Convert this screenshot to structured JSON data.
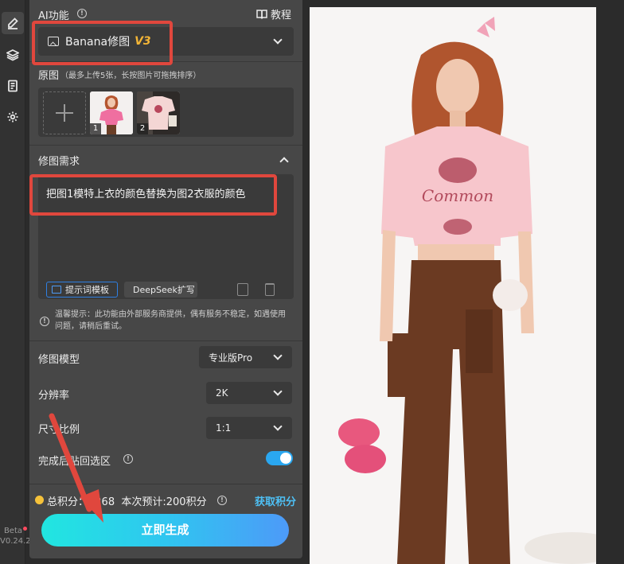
{
  "header": {
    "title": "AI功能",
    "tutorial_label": "教程"
  },
  "model_select": {
    "name": "Banana修图",
    "version_badge": "V3"
  },
  "originals": {
    "title": "原图",
    "hint": "（最多上传5张，长按图片可拖拽排序）",
    "thumbnails": [
      {
        "index": "1"
      },
      {
        "index": "2"
      }
    ]
  },
  "requirement": {
    "title": "修图需求",
    "text": "把图1模特上衣的颜色替换为图2衣服的颜色",
    "template_button": "提示词模板",
    "deepseek_button": "DeepSeek扩写"
  },
  "warning": {
    "text": "温馨提示：此功能由外部服务商提供，偶有服务不稳定，如遇使用问题，请稍后重试。"
  },
  "settings": {
    "model_label": "修图模型",
    "model_value": "专业版Pro",
    "resolution_label": "分辨率",
    "resolution_value": "2K",
    "ratio_label": "尺寸比例",
    "ratio_value": "1:1",
    "paste_back_label": "完成后贴回选区",
    "paste_back_on": true
  },
  "footer": {
    "total_points_label": "总积分：",
    "total_points_value": "7268",
    "estimate_label": "本次预计:200积分",
    "get_points": "获取积分",
    "generate_button": "立即生成"
  },
  "app": {
    "beta": "Beta",
    "version": "V0.24.2"
  },
  "colors": {
    "accent_blue": "#2aa7f0",
    "badge_gold": "#f3b536",
    "highlight_red": "#e0473d",
    "generate_gradient_start": "#21e6e0",
    "generate_gradient_end": "#4d9af8"
  }
}
